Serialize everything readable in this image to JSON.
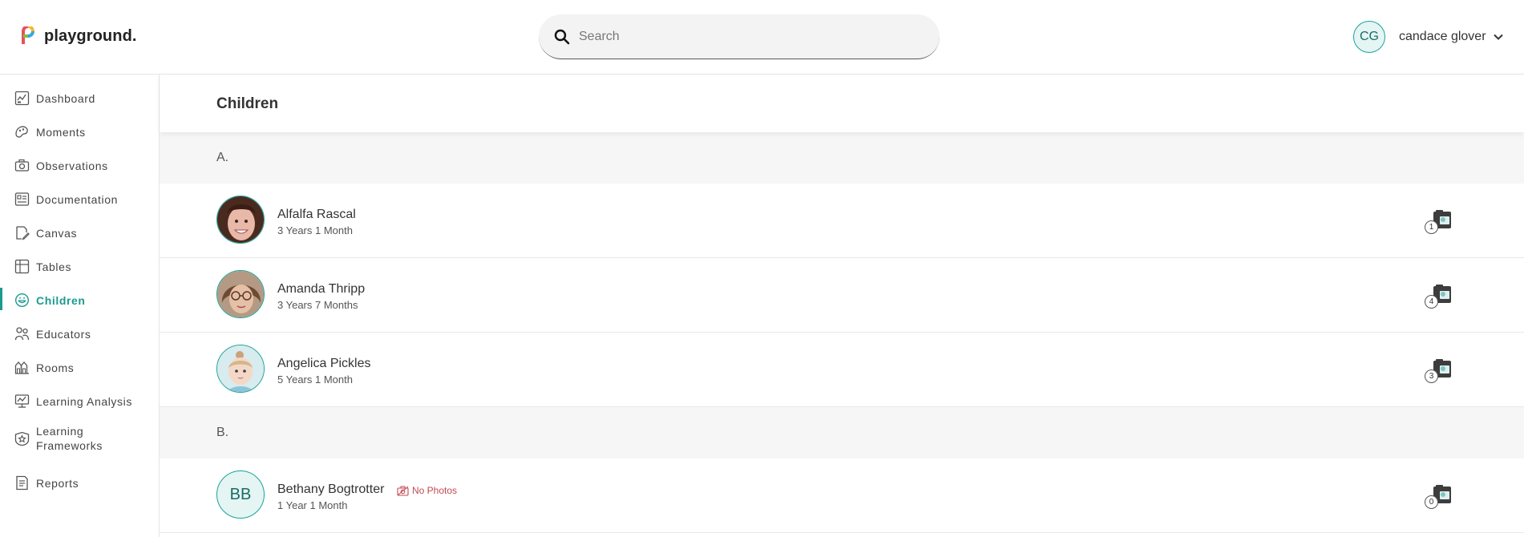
{
  "app": {
    "name": "playground."
  },
  "search": {
    "placeholder": "Search"
  },
  "user": {
    "initials": "CG",
    "name": "candace glover"
  },
  "sidebar": {
    "items": [
      {
        "label": "Dashboard",
        "icon": "dashboard-icon"
      },
      {
        "label": "Moments",
        "icon": "moments-icon"
      },
      {
        "label": "Observations",
        "icon": "camera-icon"
      },
      {
        "label": "Documentation",
        "icon": "documentation-icon"
      },
      {
        "label": "Canvas",
        "icon": "canvas-icon"
      },
      {
        "label": "Tables",
        "icon": "table-icon"
      },
      {
        "label": "Children",
        "icon": "smiley-icon",
        "active": true
      },
      {
        "label": "Educators",
        "icon": "educators-icon"
      },
      {
        "label": "Rooms",
        "icon": "rooms-icon"
      },
      {
        "label": "Learning Analysis",
        "icon": "analysis-icon"
      },
      {
        "label": "Learning\nFrameworks",
        "icon": "frameworks-icon"
      },
      {
        "label": "Reports",
        "icon": "reports-icon"
      }
    ]
  },
  "page": {
    "title": "Children"
  },
  "sections": [
    {
      "letter": "A.",
      "children": [
        {
          "name": "Alfalfa Rascal",
          "age": "3 Years 1 Month",
          "photos": "1"
        },
        {
          "name": "Amanda Thripp",
          "age": "3 Years 7 Months",
          "photos": "4"
        },
        {
          "name": "Angelica Pickles",
          "age": "5 Years 1 Month",
          "photos": "3"
        }
      ]
    },
    {
      "letter": "B.",
      "children": [
        {
          "name": "Bethany Bogtrotter",
          "age": "1 Year 1 Month",
          "photos": "0",
          "initials": "BB",
          "no_photos_label": "No Photos"
        }
      ]
    }
  ],
  "colors": {
    "accent": "#1c9a91",
    "warning": "#c14a52"
  }
}
